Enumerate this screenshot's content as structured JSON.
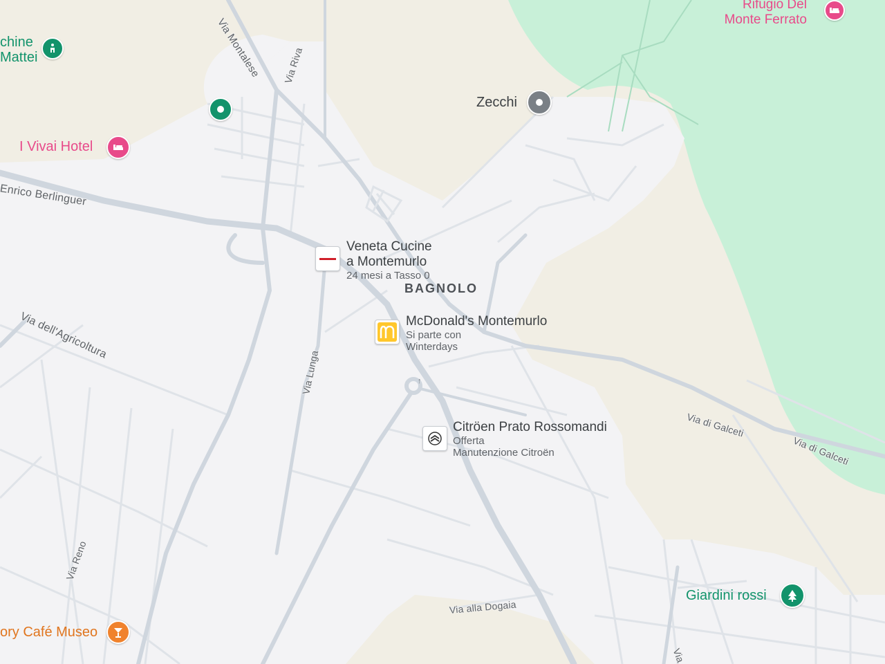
{
  "pois": {
    "rifugio": {
      "title_line1": "Rifugio Del",
      "title_line2": "Monte Ferrato",
      "icon": "hotel-bed-icon",
      "color": "#e84a8a"
    },
    "cucine": {
      "title_line1": "chine",
      "title_line2": "Mattei",
      "icon": "hiking-icon",
      "color": "#12936b"
    },
    "zecchi": {
      "title": "Zecchi",
      "icon": "generic-pin-icon",
      "color": "#7a8086"
    },
    "vivai": {
      "title": "I Vivai Hotel",
      "icon": "hotel-bed-icon",
      "color": "#e84a8a"
    },
    "veneta": {
      "title_line1": "Veneta Cucine",
      "title_line2": "a Montemurlo",
      "subtitle": "24 mesi a Tasso 0",
      "icon": "veneta-cucine-logo"
    },
    "mcdonalds": {
      "title": "McDonald's Montemurlo",
      "sub_line1": "Si parte con",
      "sub_line2": "Winterdays",
      "icon": "mcdonalds-logo",
      "brand_color": "#ffc72c"
    },
    "citroen": {
      "title": "Citröen Prato Rossomandi",
      "sub_line1": "Offerta",
      "sub_line2": "Manutenzione Citroën",
      "icon": "citroen-logo"
    },
    "giardini": {
      "title": "Giardini rossi",
      "icon": "tree-icon",
      "color": "#12936b"
    },
    "cafe": {
      "title": "ory Café Museo",
      "icon": "cocktail-icon",
      "color": "#f0822d"
    }
  },
  "places": {
    "bagnolo": "BAGNOLO"
  },
  "streets": {
    "montalese": "Via Montalese",
    "riva": "Via Riva",
    "berlinguer": "Enrico Berlinguer",
    "agricoltura": "Via dell'Agricoltura",
    "lunga": "Via Lunga",
    "galceti1": "Via di Galceti",
    "galceti2": "Via di Galceti",
    "reno": "Via Reno",
    "dogaia": "Via alla Dogaia",
    "via_cut": "Via"
  },
  "colors": {
    "land": "#f1eee4",
    "urban": "#f3f3f5",
    "park": "#c8f0d8",
    "road": "#dfe3e8",
    "major_road": "#cfd6de"
  }
}
